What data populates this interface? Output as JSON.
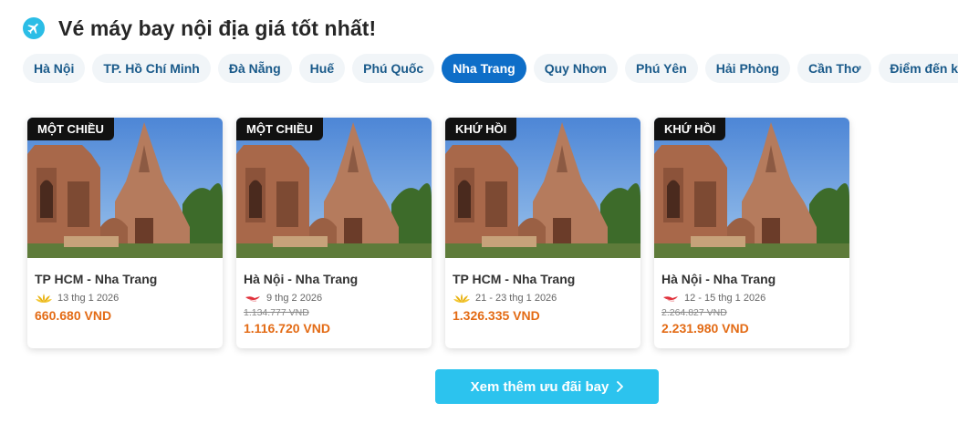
{
  "header": {
    "icon": "airplane-icon",
    "title": "Vé máy bay nội địa giá tốt nhất!"
  },
  "tabs": [
    {
      "label": "Hà Nội",
      "active": false
    },
    {
      "label": "TP. Hồ Chí Minh",
      "active": false
    },
    {
      "label": "Đà Nẵng",
      "active": false
    },
    {
      "label": "Huế",
      "active": false
    },
    {
      "label": "Phú Quốc",
      "active": false
    },
    {
      "label": "Nha Trang",
      "active": true
    },
    {
      "label": "Quy Nhơn",
      "active": false
    },
    {
      "label": "Phú Yên",
      "active": false
    },
    {
      "label": "Hải Phòng",
      "active": false
    },
    {
      "label": "Cần Thơ",
      "active": false
    },
    {
      "label": "Điểm đến khác",
      "active": false
    }
  ],
  "cards": [
    {
      "badge": "MỘT CHIỀU",
      "route": "TP HCM - Nha Trang",
      "airline_icon": "vietnam-airlines-lotus-icon",
      "date": "13 thg 1 2026",
      "old_price": "",
      "price": "660.680 VND"
    },
    {
      "badge": "MỘT CHIỀU",
      "route": "Hà Nội - Nha Trang",
      "airline_icon": "vietjet-bird-icon",
      "date": "9 thg 2 2026",
      "old_price": "1.134.777 VND",
      "price": "1.116.720 VND"
    },
    {
      "badge": "KHỨ HỒI",
      "route": "TP HCM - Nha Trang",
      "airline_icon": "vietnam-airlines-lotus-icon",
      "date": "21 - 23 thg 1 2026",
      "old_price": "",
      "price": "1.326.335 VND"
    },
    {
      "badge": "KHỨ HỒI",
      "route": "Hà Nội - Nha Trang",
      "airline_icon": "vietjet-bird-icon",
      "date": "12 - 15 thg 1 2026",
      "old_price": "2.264.827 VND",
      "price": "2.231.980 VND"
    }
  ],
  "cta": {
    "label": "Xem thêm ưu đãi bay",
    "icon": "chevron-right-icon"
  },
  "colors": {
    "accent": "#0e6ec8",
    "price": "#e36b15",
    "cta": "#2cc3ee"
  }
}
